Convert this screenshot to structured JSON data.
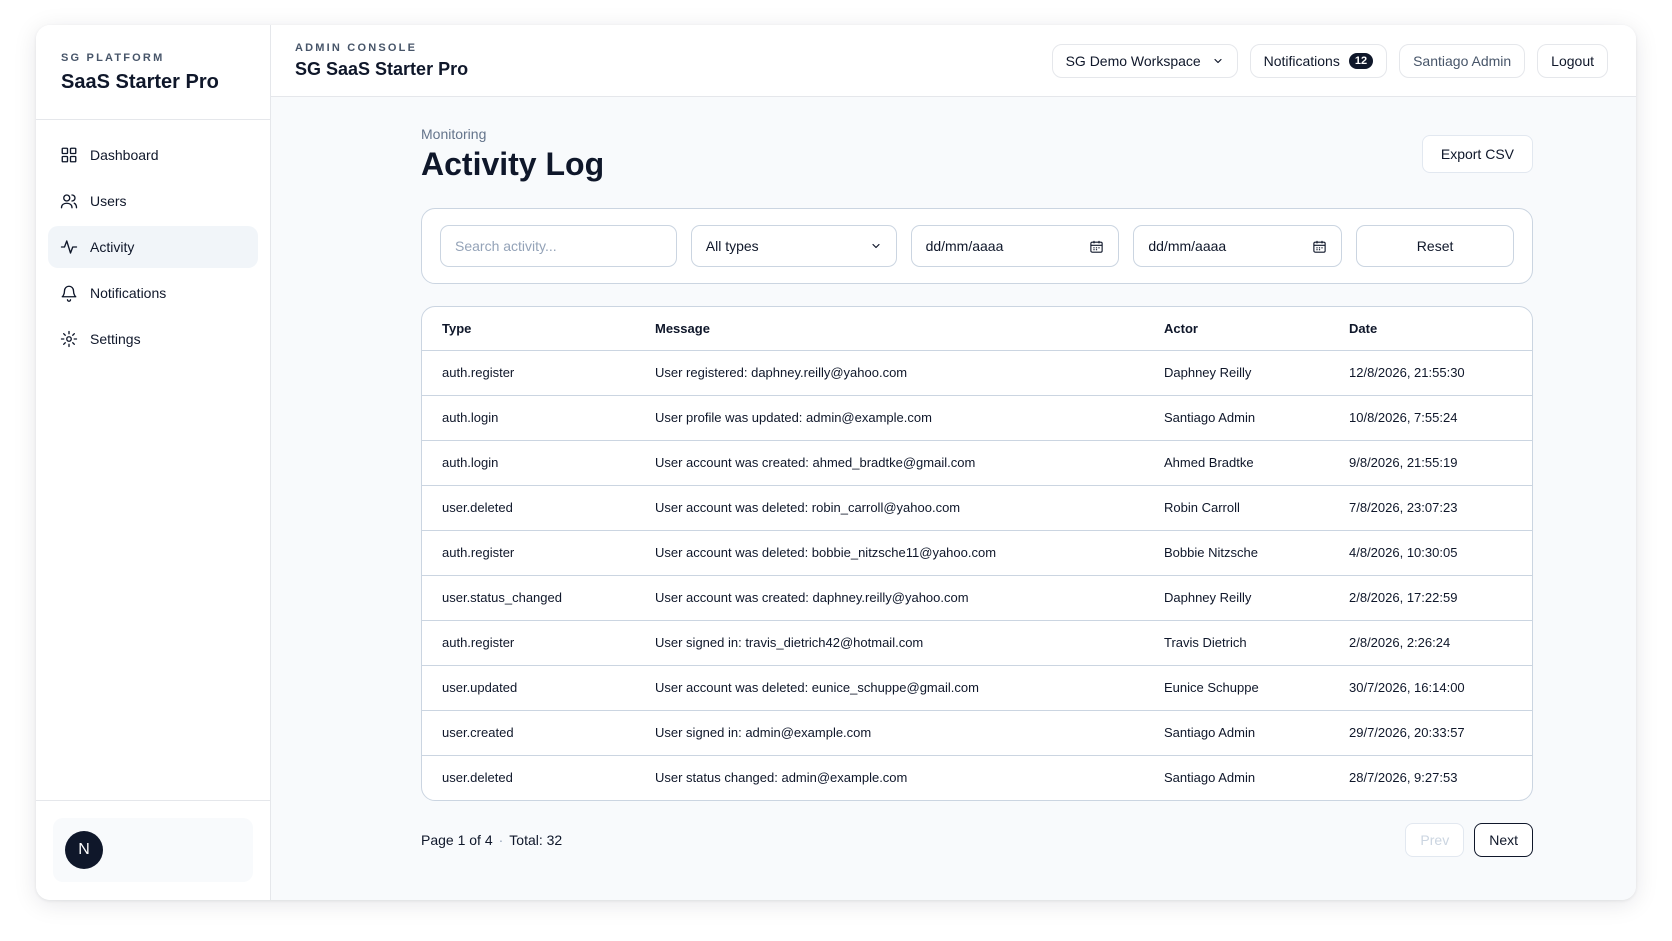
{
  "sidebar": {
    "kicker": "SG PLATFORM",
    "product_name": "SaaS Starter Pro",
    "items": [
      {
        "label": "Dashboard",
        "icon": "grid-icon",
        "active": false
      },
      {
        "label": "Users",
        "icon": "users-icon",
        "active": false
      },
      {
        "label": "Activity",
        "icon": "activity-icon",
        "active": true
      },
      {
        "label": "Notifications",
        "icon": "bell-icon",
        "active": false
      },
      {
        "label": "Settings",
        "icon": "gear-icon",
        "active": false
      }
    ],
    "avatar_initial": "N"
  },
  "topbar": {
    "kicker": "ADMIN CONSOLE",
    "title": "SG SaaS Starter Pro",
    "workspace": "SG Demo Workspace",
    "notifications_label": "Notifications",
    "notifications_count": "12",
    "user_name": "Santiago Admin",
    "logout_label": "Logout"
  },
  "page": {
    "kicker": "Monitoring",
    "title": "Activity Log",
    "export_label": "Export CSV"
  },
  "filters": {
    "search_placeholder": "Search activity...",
    "type_value": "All types",
    "date_from": "dd/mm/aaaa",
    "date_to": "dd/mm/aaaa",
    "reset_label": "Reset"
  },
  "table": {
    "columns": [
      "Type",
      "Message",
      "Actor",
      "Date"
    ],
    "rows": [
      {
        "type": "auth.register",
        "message": "User registered: daphney.reilly@yahoo.com",
        "actor": "Daphney Reilly",
        "date": "12/8/2026, 21:55:30"
      },
      {
        "type": "auth.login",
        "message": "User profile was updated: admin@example.com",
        "actor": "Santiago Admin",
        "date": "10/8/2026, 7:55:24"
      },
      {
        "type": "auth.login",
        "message": "User account was created: ahmed_bradtke@gmail.com",
        "actor": "Ahmed Bradtke",
        "date": "9/8/2026, 21:55:19"
      },
      {
        "type": "user.deleted",
        "message": "User account was deleted: robin_carroll@yahoo.com",
        "actor": "Robin Carroll",
        "date": "7/8/2026, 23:07:23"
      },
      {
        "type": "auth.register",
        "message": "User account was deleted: bobbie_nitzsche11@yahoo.com",
        "actor": "Bobbie Nitzsche",
        "date": "4/8/2026, 10:30:05"
      },
      {
        "type": "user.status_changed",
        "message": "User account was created: daphney.reilly@yahoo.com",
        "actor": "Daphney Reilly",
        "date": "2/8/2026, 17:22:59"
      },
      {
        "type": "auth.register",
        "message": "User signed in: travis_dietrich42@hotmail.com",
        "actor": "Travis Dietrich",
        "date": "2/8/2026, 2:26:24"
      },
      {
        "type": "user.updated",
        "message": "User account was deleted: eunice_schuppe@gmail.com",
        "actor": "Eunice Schuppe",
        "date": "30/7/2026, 16:14:00"
      },
      {
        "type": "user.created",
        "message": "User signed in: admin@example.com",
        "actor": "Santiago Admin",
        "date": "29/7/2026, 20:33:57"
      },
      {
        "type": "user.deleted",
        "message": "User status changed: admin@example.com",
        "actor": "Santiago Admin",
        "date": "28/7/2026, 9:27:53"
      }
    ]
  },
  "pagination": {
    "page_text": "Page 1 of 4",
    "total_text": "Total: 32",
    "prev_label": "Prev",
    "next_label": "Next"
  }
}
